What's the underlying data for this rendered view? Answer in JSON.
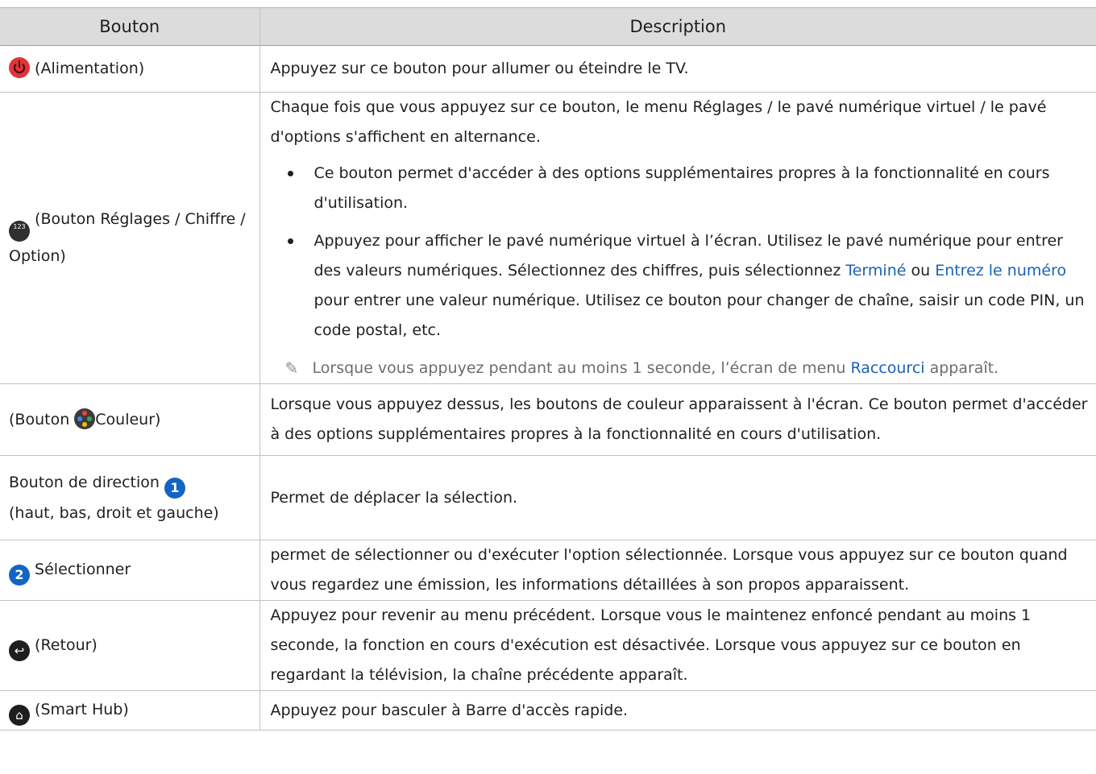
{
  "header": {
    "col1": "Bouton",
    "col2": "Description"
  },
  "rows": [
    {
      "button": "(Alimentation)",
      "desc": "Appuyez sur ce bouton pour allumer ou éteindre le TV."
    },
    {
      "button": "(Bouton Réglages / Chiffre / Option)",
      "icon_text": "123",
      "desc": "Chaque fois que vous appuyez sur ce bouton, le menu Réglages / le pavé numérique virtuel / le pavé d'options s'affichent en alternance.",
      "bullet1": "Ce bouton permet d'accéder à des options supplémentaires propres à la fonctionnalité en cours d'utilisation.",
      "bullet2_a": "Appuyez pour afficher le pavé numérique virtuel à l’écran. Utilisez le pavé numérique pour entrer des valeurs numériques. Sélectionnez des chiffres, puis sélectionnez ",
      "bullet2_link1": "Terminé",
      "bullet2_b": " ou ",
      "bullet2_link2": "Entrez le numéro",
      "bullet2_c": " pour entrer une valeur numérique. Utilisez ce bouton pour changer de chaîne, saisir un code PIN, un code postal, etc.",
      "note_a": "Lorsque vous appuyez pendant au moins 1 seconde, l’écran de menu ",
      "note_link": "Raccourci",
      "note_b": " apparaît."
    },
    {
      "button_a": "(Bouton ",
      "button_b": "Couleur)",
      "desc": "Lorsque vous appuyez dessus, les boutons de couleur apparaissent à l'écran. Ce bouton permet d'accéder à des options supplémentaires propres à la fonctionnalité en cours d'utilisation."
    },
    {
      "button_a": "Bouton de direction",
      "number": "1",
      "button_b": "(haut, bas, droit et gauche)",
      "desc": "Permet de déplacer la sélection."
    },
    {
      "number": "2",
      "button": "Sélectionner",
      "desc": "permet de sélectionner ou d'exécuter l'option sélectionnée. Lorsque vous appuyez sur ce bouton quand vous regardez une émission, les informations détaillées à son propos apparaissent."
    },
    {
      "button": "(Retour)",
      "desc": "Appuyez pour revenir au menu précédent. Lorsque vous le maintenez enfoncé pendant au moins 1 seconde, la fonction en cours d'exécution est désactivée. Lorsque vous appuyez sur ce bouton en regardant la télévision, la chaîne précédente apparaît."
    },
    {
      "button": "(Smart Hub)",
      "desc": "Appuyez pour basculer à Barre d'accès rapide."
    }
  ],
  "icons": {
    "power": "power-icon",
    "settings": "settings-number-option-icon",
    "color": "color-button-icon",
    "direction": "number-1-badge",
    "select": "number-2-badge",
    "back": "back-arrow-icon",
    "home": "home-icon",
    "note": "pencil-note-icon"
  },
  "colors": {
    "header_bg": "#dcdcdc",
    "link": "#1a62b4",
    "badge": "#1265c4",
    "power": "#e2333b"
  }
}
